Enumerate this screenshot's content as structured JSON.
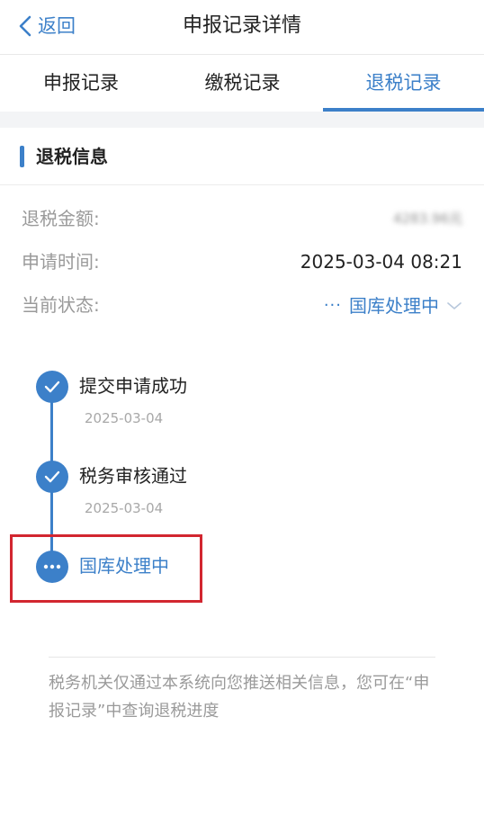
{
  "navbar": {
    "back_label": "返回",
    "title": "申报记录详情"
  },
  "tabs": [
    {
      "label": "申报记录",
      "active": false
    },
    {
      "label": "缴税记录",
      "active": false
    },
    {
      "label": "退税记录",
      "active": true
    }
  ],
  "section": {
    "title": "退税信息"
  },
  "info": {
    "refund_amount_label": "退税金额:",
    "refund_amount_value": "4283.96元",
    "apply_time_label": "申请时间:",
    "apply_time_value": "2025-03-04 08:21",
    "status_label": "当前状态:",
    "status_dots": "···",
    "status_value": "国库处理中"
  },
  "timeline": [
    {
      "title": "提交申请成功",
      "date": "2025-03-04",
      "state": "done"
    },
    {
      "title": "税务审核通过",
      "date": "2025-03-04",
      "state": "done"
    },
    {
      "title": "国库处理中",
      "date": "",
      "state": "in-progress"
    }
  ],
  "footer": {
    "note": "税务机关仅通过本系统向您推送相关信息，您可在“申报记录”中查询退税进度"
  },
  "icons": {
    "back": "chevron-left-icon",
    "status_expand": "chevron-down-icon",
    "done": "check-icon",
    "pending": "more-dots-icon"
  },
  "colors": {
    "accent": "#3c80c9",
    "highlight": "#d22630",
    "muted_text": "#9a9a9a",
    "spacer_bg": "#f3f4f6"
  }
}
